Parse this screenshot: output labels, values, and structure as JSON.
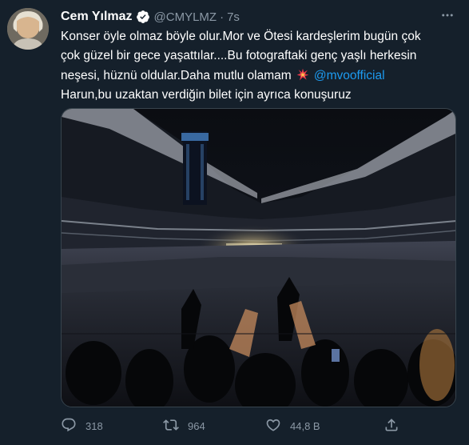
{
  "user": {
    "name": "Cem Yılmaz",
    "handle": "@CMYLMZ",
    "separator": "·",
    "time": "7s"
  },
  "tweet": {
    "line1": "Konser öyle olmaz böyle olur.Mor ve Ötesi kardeşlerim bugün çok",
    "line2": "çok güzel bir gece yaşattılar....Bu fotograftaki genç yaşlı herkesin",
    "line3_before_mention": "neşesi, hüznü oldular.Daha mutlu olamam",
    "mention": "@mvoofficial",
    "line4": "Harun,bu uzaktan verdiğin bilet için ayrıca konuşuruz",
    "emoji_icon": "collision-icon"
  },
  "media": {
    "alt_icon": "stadium-concert-photo"
  },
  "actions": {
    "reply_count": "318",
    "retweet_count": "964",
    "like_count": "44,8 B"
  },
  "colors": {
    "background": "#15202b",
    "muted": "#8b98a5",
    "link": "#1d9bf0",
    "verified": "#ffffff"
  }
}
